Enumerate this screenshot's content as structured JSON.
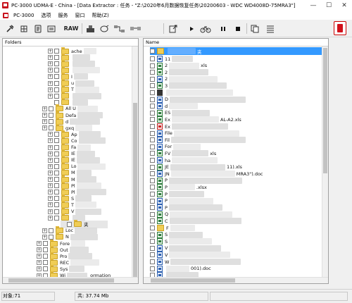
{
  "window": {
    "title": "PC-3000 UDMA-E - China - [Data Extractor : 任务 - \"Z:\\2020年6月数据恢复任务\\20200603 - WDC WD4008D-75MRA3\"]",
    "controls": [
      "—",
      "☐",
      "✕"
    ]
  },
  "menu": {
    "items": [
      "PC-3000",
      "选项",
      "服务",
      "窗口",
      "帮助(Z)"
    ]
  },
  "toolbar": {
    "raw_label": "RAW"
  },
  "left_panel": {
    "header": "Folders",
    "items": [
      {
        "label": "ache"
      },
      {
        "label": ""
      },
      {
        "label": ""
      },
      {
        "label": ""
      },
      {
        "label": "I"
      },
      {
        "label": "u"
      },
      {
        "label": "T"
      },
      {
        "label": ""
      },
      {
        "label": ""
      },
      {
        "label": "All U"
      },
      {
        "label": "Defa"
      },
      {
        "label": "d"
      },
      {
        "label": "gxq"
      },
      {
        "label": "Ap"
      },
      {
        "label": "Co"
      },
      {
        "label": "Fa"
      },
      {
        "label": "IE"
      },
      {
        "label": "IE"
      },
      {
        "label": "Lo"
      },
      {
        "label": "M"
      },
      {
        "label": "M"
      },
      {
        "label": "Pl"
      },
      {
        "label": "Pl"
      },
      {
        "label": "S"
      },
      {
        "label": "T"
      },
      {
        "label": "V"
      },
      {
        "label": ""
      },
      {
        "label": "夹"
      },
      {
        "label": "Loc"
      },
      {
        "label": "N"
      },
      {
        "label": "Fore"
      },
      {
        "label": "Out"
      },
      {
        "label": "Pro"
      },
      {
        "label": "REC"
      },
      {
        "label": "Sys"
      },
      {
        "label": "Wi"
      }
    ],
    "system_info_fragment": "ormation"
  },
  "right_panel": {
    "header": "Name",
    "selected_fragment": "夹",
    "files": [
      {
        "label": "11",
        "kind": "doc"
      },
      {
        "label": "2",
        "kind": "xls",
        "suffix": "xls"
      },
      {
        "label": "2",
        "kind": "xls"
      },
      {
        "label": "2",
        "kind": "doc"
      },
      {
        "label": "3",
        "kind": "xls"
      },
      {
        "label": "",
        "kind": "img"
      },
      {
        "label": "D",
        "kind": "doc"
      },
      {
        "label": "d",
        "kind": "doc"
      },
      {
        "label": "ES",
        "kind": "xls"
      },
      {
        "label": "Ex",
        "kind": "xls",
        "suffix": "AL-A2.xls"
      },
      {
        "label": "Ex",
        "kind": "pdf"
      },
      {
        "label": "File",
        "kind": "doc"
      },
      {
        "label": "Fil",
        "kind": "doc"
      },
      {
        "label": "For",
        "kind": "doc"
      },
      {
        "label": "FV",
        "kind": "xls",
        "suffix": "xls"
      },
      {
        "label": "ha",
        "kind": "doc"
      },
      {
        "label": "JE",
        "kind": "xls",
        "suffix": "11).xls"
      },
      {
        "label": "JN",
        "kind": "doc",
        "suffix": "MRA3\").doc"
      },
      {
        "label": "P",
        "kind": "xls"
      },
      {
        "label": "P",
        "kind": "xls",
        "suffix": ".xlsx"
      },
      {
        "label": "P",
        "kind": "xls"
      },
      {
        "label": "P",
        "kind": "doc"
      },
      {
        "label": "P",
        "kind": "doc"
      },
      {
        "label": "Q",
        "kind": "xls"
      },
      {
        "label": "C",
        "kind": "xls"
      },
      {
        "label": "F",
        "kind": "fld"
      },
      {
        "label": "S",
        "kind": "xls"
      },
      {
        "label": "S",
        "kind": "xls"
      },
      {
        "label": "V",
        "kind": "doc"
      },
      {
        "label": "V",
        "kind": "doc"
      },
      {
        "label": "W",
        "kind": "doc"
      },
      {
        "label": "",
        "kind": "doc",
        "suffix": "001).doc"
      },
      {
        "label": "",
        "kind": "doc"
      }
    ]
  },
  "status": {
    "objects": "对象:71",
    "total": "共: 37.74 Mb"
  },
  "colors": {
    "selection": "#3399ff",
    "folder": "#f0cd55",
    "stop_icon": "#d0101a"
  }
}
